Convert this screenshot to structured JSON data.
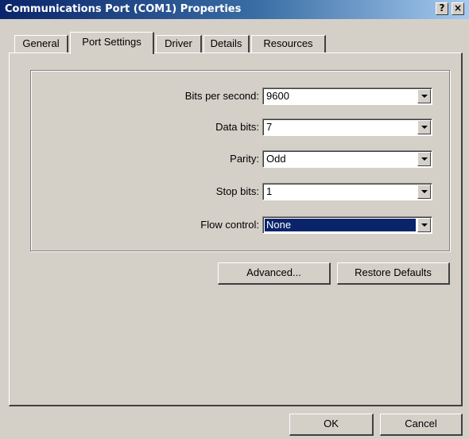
{
  "window": {
    "title": "Communications Port (COM1) Properties",
    "help_button": "?",
    "close_button": "×"
  },
  "tabs": [
    {
      "label": "General"
    },
    {
      "label": "Port Settings",
      "active": true
    },
    {
      "label": "Driver"
    },
    {
      "label": "Details"
    },
    {
      "label": "Resources"
    }
  ],
  "settings": {
    "bits_per_second": {
      "label": "Bits per second:",
      "value": "9600"
    },
    "data_bits": {
      "label": "Data bits:",
      "value": "7"
    },
    "parity": {
      "label": "Parity:",
      "value": "Odd"
    },
    "stop_bits": {
      "label": "Stop bits:",
      "value": "1"
    },
    "flow_control": {
      "label": "Flow control:",
      "value": "None"
    }
  },
  "buttons": {
    "advanced": "Advanced...",
    "restore_defaults": "Restore Defaults",
    "ok": "OK",
    "cancel": "Cancel"
  },
  "colors": {
    "titlebar_start": "#0a246a",
    "titlebar_end": "#a6caf0",
    "dialog_bg": "#d4d0c8",
    "selection": "#0a246a"
  }
}
